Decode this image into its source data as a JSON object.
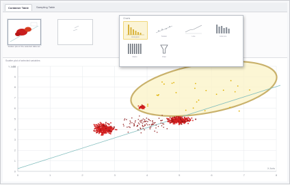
{
  "tabs": [
    {
      "label": "Container Table",
      "active": true
    },
    {
      "label": "Sampling Table",
      "active": false
    }
  ],
  "gallery": {
    "thumb1_caption": "Scatter plot of the selected data set",
    "thumb2_caption": ""
  },
  "picker": {
    "header": "Charts",
    "options": [
      {
        "icon": "bar-chart-icon",
        "caption": "Histogram",
        "active": true
      },
      {
        "icon": "scatter-chart-icon",
        "caption": "Scatter",
        "active": false
      },
      {
        "icon": "line-chart-icon",
        "caption": "Line",
        "active": false
      },
      {
        "icon": "column-chart-icon",
        "caption": "Columns",
        "active": false
      },
      {
        "icon": "grid-chart-icon",
        "caption": "Matrix",
        "active": false
      },
      {
        "icon": "funnel-icon",
        "caption": "Filter",
        "active": false
      }
    ]
  },
  "plot": {
    "caption": "Scatter plot of selected variables",
    "y_axis_label": "Y Axis",
    "x_axis_label": "X Axis",
    "y_ticks": [
      "10",
      "9",
      "8",
      "7",
      "6",
      "5",
      "4",
      "3",
      "2",
      "1",
      "0"
    ],
    "x_ticks": [
      "0",
      "1",
      "2",
      "3",
      "4",
      "5",
      "6",
      "7",
      "8"
    ],
    "colors": {
      "cluster": "#d42020",
      "cluster_dark": "#8a1010",
      "highlight": "#e0b000",
      "ellipse_fill": "#fbf3c6",
      "ellipse_stroke": "#c9b16b",
      "trend": "#7fbcbc",
      "grid": "#e6e8ec"
    }
  }
}
